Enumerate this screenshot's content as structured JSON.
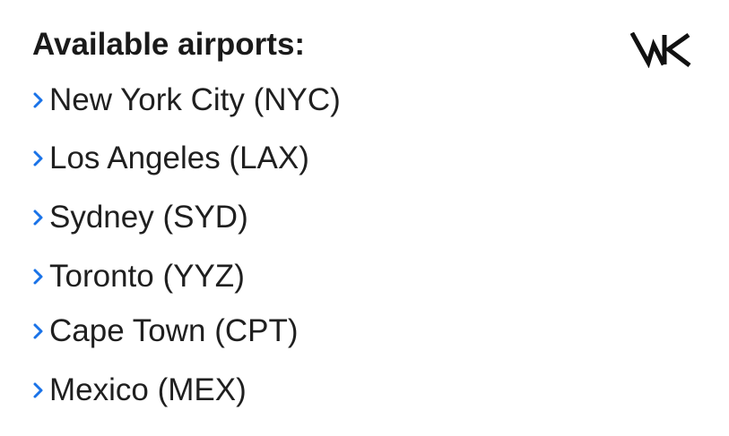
{
  "header": {
    "title": "Available airports:",
    "logo_icon": "mk-monogram-icon"
  },
  "airports": {
    "bullet_icon": "chevron-right-icon",
    "bullet_color": "#1a73e8",
    "items": [
      {
        "label": "New York City (NYC)"
      },
      {
        "label": "Los Angeles (LAX)"
      },
      {
        "label": "Sydney (SYD)"
      },
      {
        "label": "Toronto (YYZ)"
      },
      {
        "label": "Cape Town (CPT)"
      },
      {
        "label": "Mexico (MEX)"
      }
    ]
  }
}
